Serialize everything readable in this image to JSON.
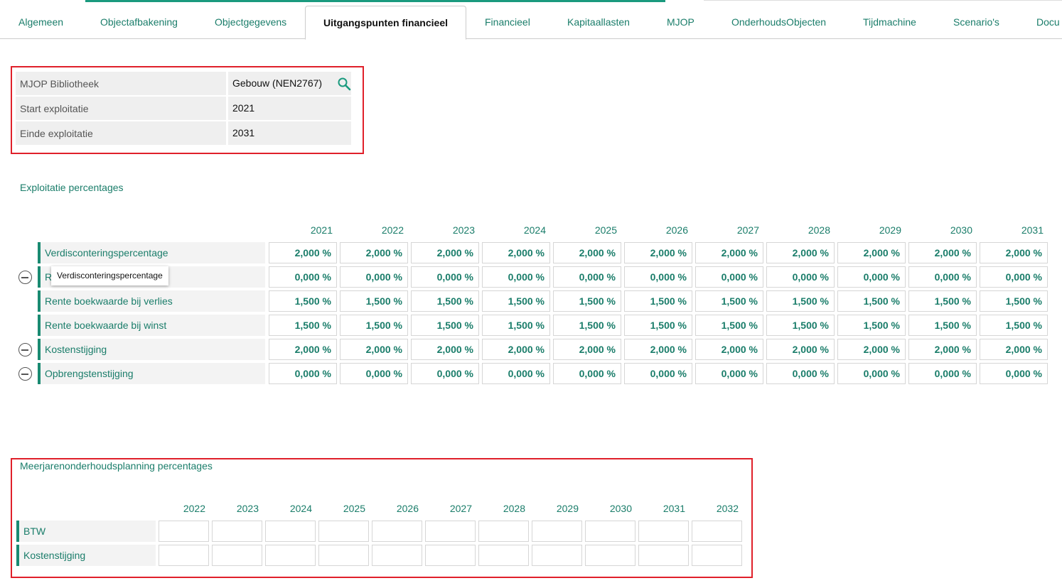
{
  "tabs": [
    {
      "label": "Algemeen",
      "active": false
    },
    {
      "label": "Objectafbakening",
      "active": false
    },
    {
      "label": "Objectgegevens",
      "active": false
    },
    {
      "label": "Uitgangspunten financieel",
      "active": true
    },
    {
      "label": "Financieel",
      "active": false
    },
    {
      "label": "Kapitaallasten",
      "active": false
    },
    {
      "label": "MJOP",
      "active": false
    },
    {
      "label": "OnderhoudsObjecten",
      "active": false
    },
    {
      "label": "Tijdmachine",
      "active": false
    },
    {
      "label": "Scenario's",
      "active": false
    },
    {
      "label": "Docu",
      "active": false
    }
  ],
  "info": {
    "mjop_label": "MJOP Bibliotheek",
    "mjop_value": "Gebouw (NEN2767)",
    "start_label": "Start exploitatie",
    "start_value": "2021",
    "einde_label": "Einde exploitatie",
    "einde_value": "2031"
  },
  "exploitatie": {
    "title": "Exploitatie percentages",
    "years": [
      "2021",
      "2022",
      "2023",
      "2024",
      "2025",
      "2026",
      "2027",
      "2028",
      "2029",
      "2030",
      "2031"
    ],
    "rows": [
      {
        "label": "Verdisconteringspercentage",
        "removable": false,
        "values": [
          "2,000 %",
          "2,000 %",
          "2,000 %",
          "2,000 %",
          "2,000 %",
          "2,000 %",
          "2,000 %",
          "2,000 %",
          "2,000 %",
          "2,000 %",
          "2,000 %"
        ]
      },
      {
        "label": "R",
        "removable": true,
        "values": [
          "0,000 %",
          "0,000 %",
          "0,000 %",
          "0,000 %",
          "0,000 %",
          "0,000 %",
          "0,000 %",
          "0,000 %",
          "0,000 %",
          "0,000 %",
          "0,000 %"
        ]
      },
      {
        "label": "Rente boekwaarde bij verlies",
        "removable": false,
        "values": [
          "1,500 %",
          "1,500 %",
          "1,500 %",
          "1,500 %",
          "1,500 %",
          "1,500 %",
          "1,500 %",
          "1,500 %",
          "1,500 %",
          "1,500 %",
          "1,500 %"
        ]
      },
      {
        "label": "Rente boekwaarde bij winst",
        "removable": false,
        "values": [
          "1,500 %",
          "1,500 %",
          "1,500 %",
          "1,500 %",
          "1,500 %",
          "1,500 %",
          "1,500 %",
          "1,500 %",
          "1,500 %",
          "1,500 %",
          "1,500 %"
        ]
      },
      {
        "label": "Kostenstijging",
        "removable": true,
        "values": [
          "2,000 %",
          "2,000 %",
          "2,000 %",
          "2,000 %",
          "2,000 %",
          "2,000 %",
          "2,000 %",
          "2,000 %",
          "2,000 %",
          "2,000 %",
          "2,000 %"
        ]
      },
      {
        "label": "Opbrengstenstijging",
        "removable": true,
        "values": [
          "0,000 %",
          "0,000 %",
          "0,000 %",
          "0,000 %",
          "0,000 %",
          "0,000 %",
          "0,000 %",
          "0,000 %",
          "0,000 %",
          "0,000 %",
          "0,000 %"
        ]
      }
    ],
    "tooltip": "Verdisconteringspercentage"
  },
  "mjop": {
    "title": "Meerjarenonderhoudsplanning percentages",
    "years": [
      "2022",
      "2023",
      "2024",
      "2025",
      "2026",
      "2027",
      "2028",
      "2029",
      "2030",
      "2031",
      "2032"
    ],
    "rows": [
      {
        "label": "BTW",
        "values": [
          "",
          "",
          "",
          "",
          "",
          "",
          "",
          "",
          "",
          "",
          ""
        ]
      },
      {
        "label": "Kostenstijging",
        "values": [
          "",
          "",
          "",
          "",
          "",
          "",
          "",
          "",
          "",
          "",
          ""
        ]
      }
    ]
  }
}
